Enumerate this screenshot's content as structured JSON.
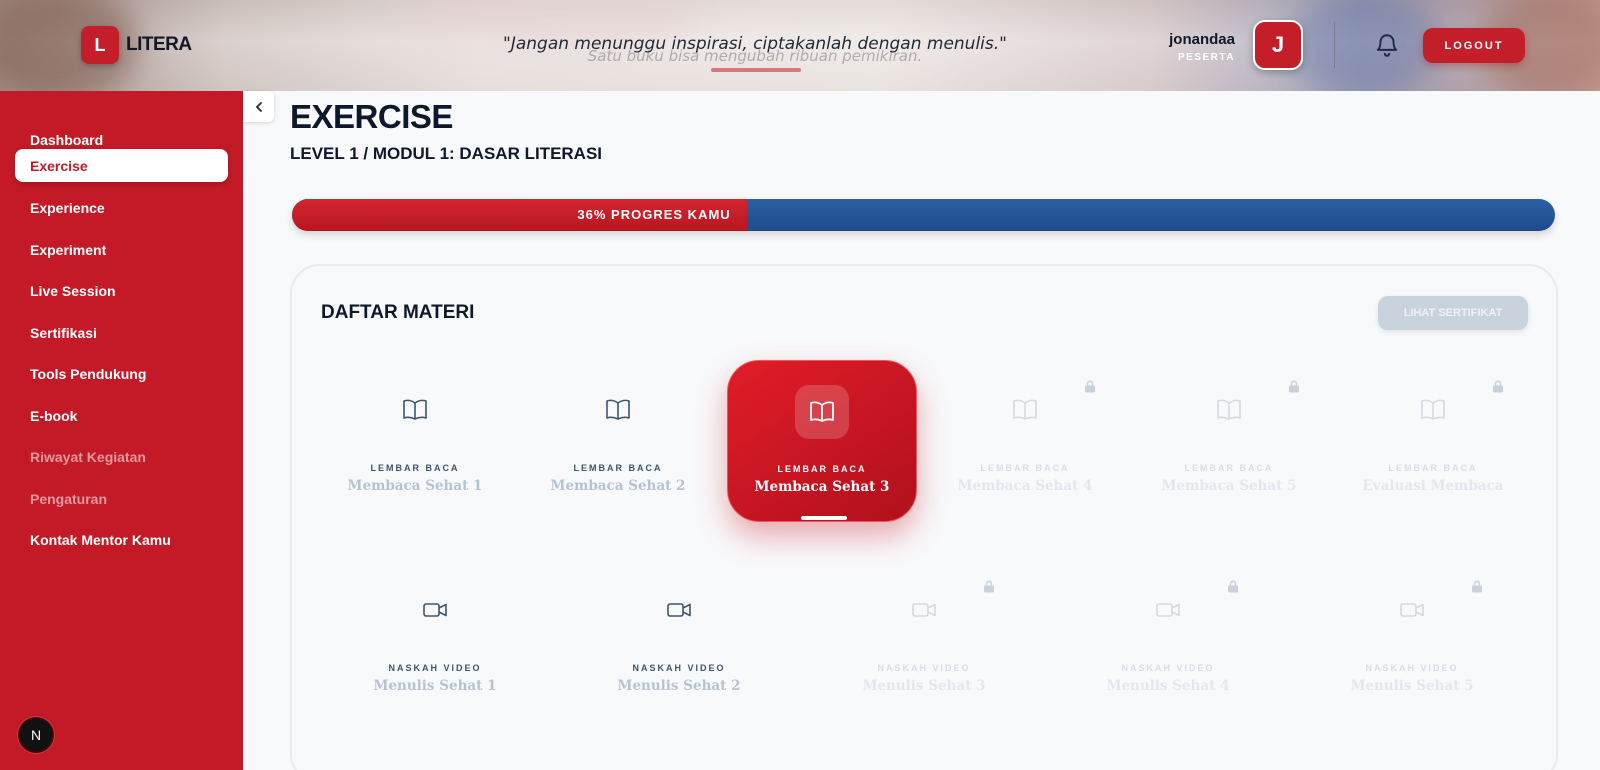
{
  "header": {
    "logo_letter": "L",
    "logo_text": "LITERA",
    "quote": "\"Jangan menunggu inspirasi, ciptakanlah dengan menulis.\"",
    "quote_faded": "Satu buku bisa mengubah ribuan pemikiran.",
    "user_name": "jonandaa",
    "user_role": "PESERTA",
    "avatar_letter": "J",
    "logout_label": "LOGOUT"
  },
  "sidebar": {
    "items": [
      {
        "label": "Dashboard"
      },
      {
        "label": "Exercise"
      },
      {
        "label": "Experience"
      },
      {
        "label": "Experiment"
      },
      {
        "label": "Live Session"
      },
      {
        "label": "Sertifikasi"
      },
      {
        "label": "Tools Pendukung"
      },
      {
        "label": "E-book"
      },
      {
        "label": "Riwayat Kegiatan"
      },
      {
        "label": "Pengaturan"
      },
      {
        "label": "Kontak Mentor Kamu"
      }
    ],
    "active_index": 1,
    "badge_letter": "N"
  },
  "main": {
    "title": "EXERCISE",
    "breadcrumb": "LEVEL 1 / MODUL 1: DASAR LITERASI",
    "progress_percent": 36,
    "progress_label": "36% PROGRES KAMU",
    "panel_title": "DAFTAR MATERI",
    "certificate_label": "LIHAT SERTIFIKAT",
    "reading_cards": [
      {
        "kind": "LEMBAR BACA",
        "title": "Membaca Sehat 1"
      },
      {
        "kind": "LEMBAR BACA",
        "title": "Membaca Sehat 2"
      },
      {
        "kind": "LEMBAR BACA",
        "title": "Membaca Sehat 3"
      },
      {
        "kind": "LEMBAR BACA",
        "title": "Membaca Sehat 4"
      },
      {
        "kind": "LEMBAR BACA",
        "title": "Membaca Sehat 5"
      },
      {
        "kind": "LEMBAR BACA",
        "title": "Evaluasi Membaca"
      }
    ],
    "video_cards": [
      {
        "kind": "NASKAH VIDEO",
        "title": "Menulis Sehat 1"
      },
      {
        "kind": "NASKAH VIDEO",
        "title": "Menulis Sehat 2"
      },
      {
        "kind": "NASKAH VIDEO",
        "title": "Menulis Sehat 3"
      },
      {
        "kind": "NASKAH VIDEO",
        "title": "Menulis Sehat 4"
      },
      {
        "kind": "NASKAH VIDEO",
        "title": "Menulis Sehat 5"
      }
    ]
  },
  "icons": {
    "book": "book-open-icon",
    "video": "video-camera-icon",
    "lock": "lock-icon",
    "bell": "bell-icon",
    "collapse": "chevron-left-icon"
  },
  "colors": {
    "brand_red": "#c41a27",
    "progress_blue": "#1e4b8a",
    "dark_text": "#0f172a"
  }
}
